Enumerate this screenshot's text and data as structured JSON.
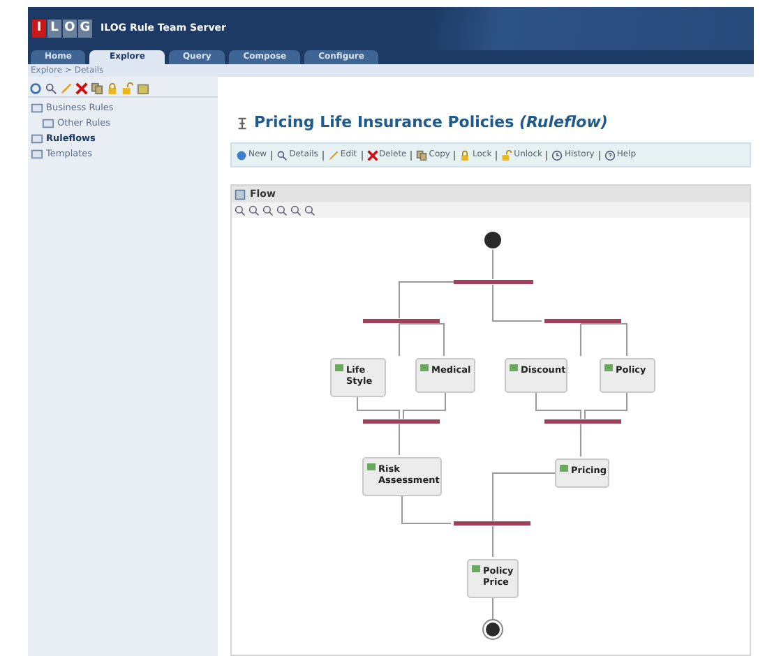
{
  "app": {
    "logo": [
      "I",
      "L",
      "O",
      "G"
    ],
    "title": "ILOG Rule Team Server"
  },
  "tabs": [
    {
      "label": "Home",
      "selected": false
    },
    {
      "label": "Explore",
      "selected": true
    },
    {
      "label": "Query",
      "selected": false
    },
    {
      "label": "Compose",
      "selected": false
    },
    {
      "label": "Configure",
      "selected": false
    }
  ],
  "breadcrumb": "Explore > Details",
  "tree": [
    {
      "label": "Business Rules",
      "selected": false,
      "children": [
        {
          "label": "Other Rules",
          "selected": false
        }
      ]
    },
    {
      "label": "Ruleflows",
      "selected": true
    },
    {
      "label": "Templates",
      "selected": false
    }
  ],
  "page_title": "Pricing Life Insurance Policies *(Ruleflow)*",
  "actions": [
    "New",
    "Details",
    "Edit",
    "Delete",
    "Copy",
    "Lock",
    "Unlock",
    "History",
    "Help"
  ],
  "flow_panel": {
    "title": "Flow",
    "nodes": [
      {
        "label": "Life Style"
      },
      {
        "label": "Medical"
      },
      {
        "label": "Discount"
      },
      {
        "label": "Policy"
      },
      {
        "label": "Risk Assessment"
      },
      {
        "label": "Pricing"
      },
      {
        "label": "Policy Price"
      }
    ]
  }
}
